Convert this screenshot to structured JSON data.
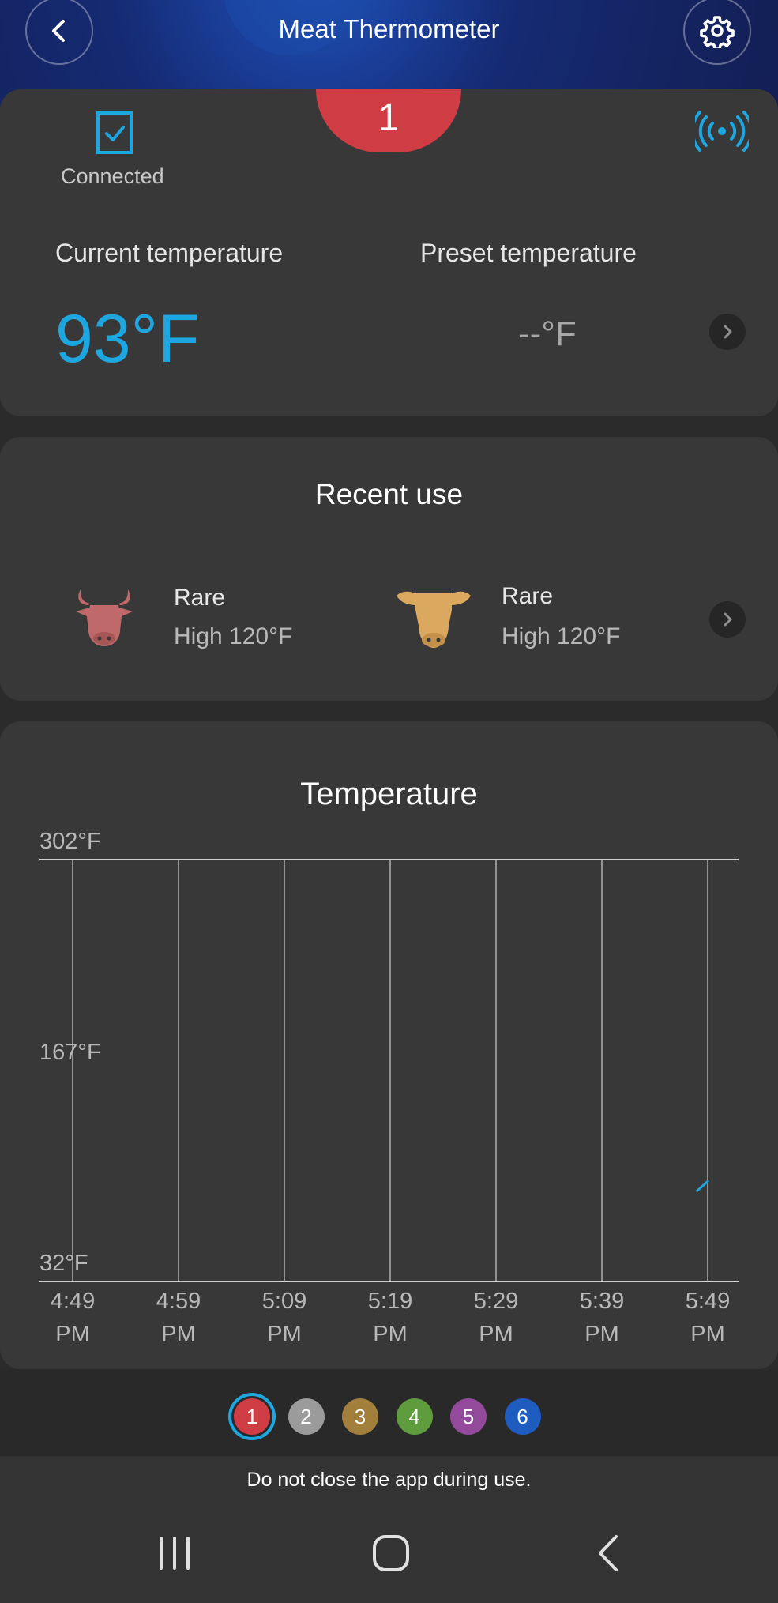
{
  "header": {
    "title": "Meat Thermometer",
    "back_icon": "chevron-left-icon",
    "settings_icon": "gear-icon"
  },
  "probe_badge": "1",
  "status": {
    "connection_label": "Connected",
    "signal_icon": "wireless-signal-icon"
  },
  "temperatures": {
    "current_label": "Current temperature",
    "current_value": "93°F",
    "preset_label": "Preset temperature",
    "preset_value": "--°F"
  },
  "recent_use": {
    "title": "Recent use",
    "items": [
      {
        "icon": "bull-head-icon",
        "doneness": "Rare",
        "detail": "High 120°F",
        "color": "#c0696a"
      },
      {
        "icon": "cow-head-icon",
        "doneness": "Rare",
        "detail": "High 120°F",
        "color": "#daa85e"
      }
    ]
  },
  "chart_data": {
    "type": "line",
    "title": "Temperature",
    "y_ticks": [
      "302°F",
      "167°F",
      "32°F"
    ],
    "ylim": [
      32,
      302
    ],
    "x_ticks": [
      {
        "time": "4:49",
        "period": "PM"
      },
      {
        "time": "4:59",
        "period": "PM"
      },
      {
        "time": "5:09",
        "period": "PM"
      },
      {
        "time": "5:19",
        "period": "PM"
      },
      {
        "time": "5:29",
        "period": "PM"
      },
      {
        "time": "5:39",
        "period": "PM"
      },
      {
        "time": "5:49",
        "period": "PM"
      }
    ],
    "grid": true,
    "series": [
      {
        "x": [
          "5:48 PM",
          "5:49 PM"
        ],
        "values": [
          90,
          96
        ],
        "color": "#1ea6e0"
      }
    ]
  },
  "probe_selector": {
    "selected": "1",
    "probes": [
      {
        "label": "1",
        "color": "#cf3c44"
      },
      {
        "label": "2",
        "color": "#9b9b9b"
      },
      {
        "label": "3",
        "color": "#a2803c"
      },
      {
        "label": "4",
        "color": "#5e9c3e"
      },
      {
        "label": "5",
        "color": "#944a9a"
      },
      {
        "label": "6",
        "color": "#1e5cc0"
      }
    ]
  },
  "footer_message": "Do not close the app during use.",
  "navigation": {
    "recents_icon": "recent-apps-icon",
    "home_icon": "home-icon",
    "back_icon": "back-nav-icon"
  },
  "colors": {
    "accent": "#1ea6e0",
    "card": "#383838",
    "background": "#2b2b2b"
  }
}
